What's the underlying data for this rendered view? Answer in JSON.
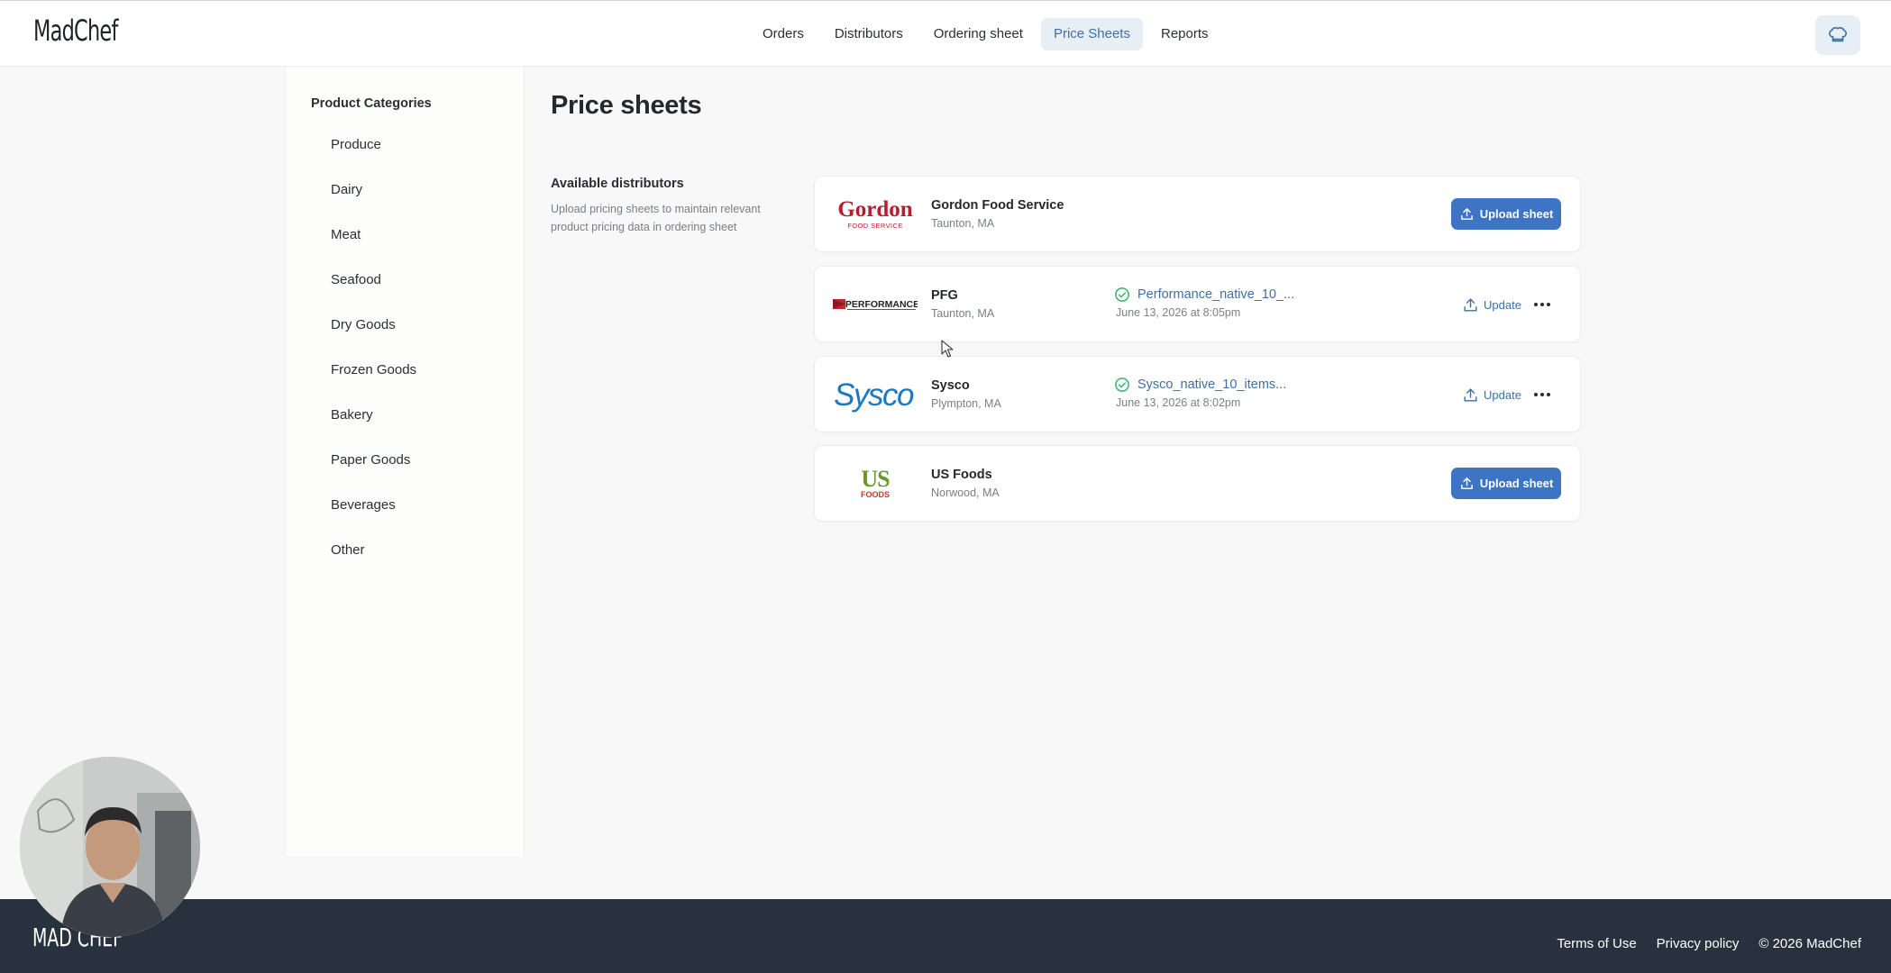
{
  "app": {
    "logo_text": "MadChef"
  },
  "nav": {
    "items": [
      {
        "label": "Orders",
        "active": false
      },
      {
        "label": "Distributors",
        "active": false
      },
      {
        "label": "Ordering sheet",
        "active": false
      },
      {
        "label": "Price Sheets",
        "active": true
      },
      {
        "label": "Reports",
        "active": false
      }
    ],
    "profile_icon": "chef-hat-icon"
  },
  "sidebar": {
    "title": "Product Categories",
    "items": [
      {
        "label": "Produce"
      },
      {
        "label": "Dairy"
      },
      {
        "label": "Meat"
      },
      {
        "label": "Seafood"
      },
      {
        "label": "Dry Goods"
      },
      {
        "label": "Frozen Goods"
      },
      {
        "label": "Bakery"
      },
      {
        "label": "Paper Goods"
      },
      {
        "label": "Beverages"
      },
      {
        "label": "Other"
      }
    ]
  },
  "main": {
    "title": "Price sheets",
    "section_title": "Available distributors",
    "section_description": "Upload pricing sheets to maintain relevant product pricing data in ordering sheet",
    "distributors": [
      {
        "name": "Gordon Food Service",
        "location": "Taunton, MA",
        "logo_text": "Gordon",
        "logo_subtext": "FOOD SERVICE",
        "action_label": "Upload sheet"
      },
      {
        "name": "PFG",
        "location": "Taunton, MA",
        "logo_text": "PERFORMANCE",
        "file_name": "Performance_native_10_...",
        "file_date": "June 13, 2026 at 8:05pm",
        "action_label": "Update"
      },
      {
        "name": "Sysco",
        "location": "Plympton, MA",
        "logo_text": "Sysco",
        "file_name": "Sysco_native_10_items...",
        "file_date": "June 13, 2026 at 8:02pm",
        "action_label": "Update"
      },
      {
        "name": "US Foods",
        "location": "Norwood, MA",
        "logo_text": "US",
        "logo_subtext": "FOODS",
        "action_label": "Upload sheet"
      }
    ]
  },
  "footer": {
    "logo_text": "MAD CHEF",
    "links": [
      "Terms of Use",
      "Privacy policy",
      "© 2026 MadChef"
    ]
  },
  "colors": {
    "accent": "#3d74c4",
    "link": "#3f6fa6",
    "nav_active_bg": "#e7eef6",
    "footer_bg": "#28323e",
    "success": "#37b26c"
  }
}
